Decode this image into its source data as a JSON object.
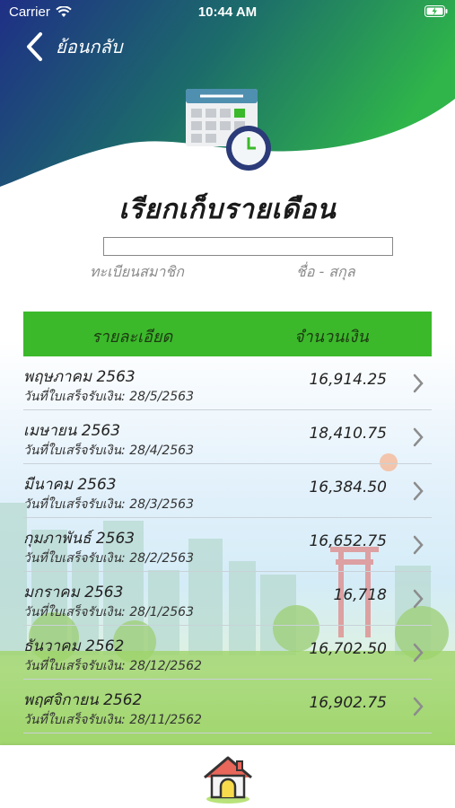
{
  "status_bar": {
    "carrier": "Carrier",
    "time": "10:44 AM"
  },
  "nav": {
    "back_label": "ย้อนกลับ"
  },
  "page": {
    "title": "เรียกเก็บรายเดือน"
  },
  "member": {
    "id_label": "ทะเบียนสมาชิก",
    "name_label": "ชื่อ - สกุล"
  },
  "table": {
    "header_detail": "รายละเอียด",
    "header_amount": "จำนวนเงิน",
    "rows": [
      {
        "month": "พฤษภาคม 2563",
        "paid_date": "วันที่ใบเสร็จรับเงิน: 28/5/2563",
        "amount": "16,914.25"
      },
      {
        "month": "เมษายน 2563",
        "paid_date": "วันที่ใบเสร็จรับเงิน: 28/4/2563",
        "amount": "18,410.75"
      },
      {
        "month": "มีนาคม 2563",
        "paid_date": "วันที่ใบเสร็จรับเงิน: 28/3/2563",
        "amount": "16,384.50"
      },
      {
        "month": "กุมภาพันธ์ 2563",
        "paid_date": "วันที่ใบเสร็จรับเงิน: 28/2/2563",
        "amount": "16,652.75"
      },
      {
        "month": "มกราคม 2563",
        "paid_date": "วันที่ใบเสร็จรับเงิน: 28/1/2563",
        "amount": "16,718"
      },
      {
        "month": "ธันวาคม 2562",
        "paid_date": "วันที่ใบเสร็จรับเงิน: 28/12/2562",
        "amount": "16,702.50"
      },
      {
        "month": "พฤศจิกายน 2562",
        "paid_date": "วันที่ใบเสร็จรับเงิน: 28/11/2562",
        "amount": "16,902.75"
      }
    ]
  },
  "colors": {
    "header_green": "#3bb92b",
    "wave_blue": "#1f3c8c",
    "wave_green": "#2fb54a"
  },
  "icons": {
    "back": "chevron-left-icon",
    "calendar": "calendar-clock-icon",
    "row_chevron": "chevron-right-icon",
    "home": "home-icon"
  }
}
